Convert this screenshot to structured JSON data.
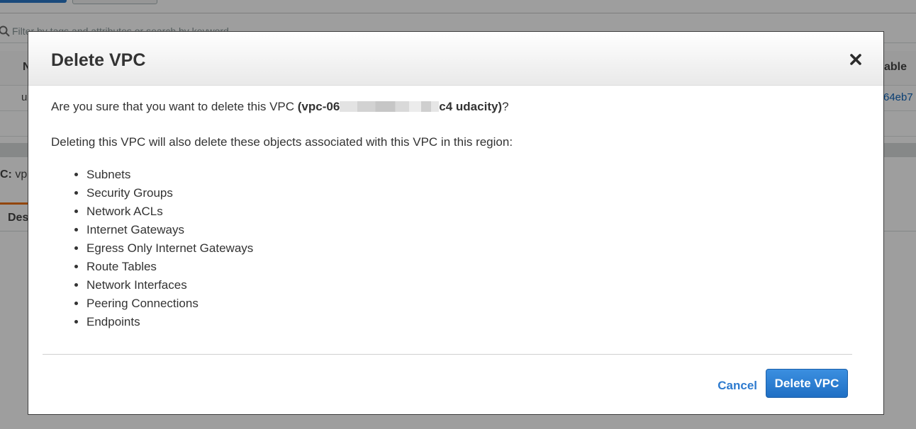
{
  "background": {
    "search_placeholder": "Filter by tags and attributes or search by keyword",
    "table_header": {
      "name_col_fragment": "N",
      "right_col_fragment": "able"
    },
    "row": {
      "name_fragment": "u",
      "right_fragment": "64eb7"
    },
    "detail": {
      "label": "C:",
      "value_fragment": "vp"
    },
    "tab_label_fragment": "Des"
  },
  "modal": {
    "title": "Delete VPC",
    "question_prefix": "Are you sure that you want to delete this VPC ",
    "vpc_open": "(vpc-06",
    "vpc_close": "c4 udacity)",
    "question_suffix": "?",
    "info": "Deleting this VPC will also delete these objects associated with this VPC in this region:",
    "objects": [
      "Subnets",
      "Security Groups",
      "Network ACLs",
      "Internet Gateways",
      "Egress Only Internet Gateways",
      "Route Tables",
      "Network Interfaces",
      "Peering Connections",
      "Endpoints"
    ],
    "cancel_label": "Cancel",
    "delete_label": "Delete VPC"
  },
  "colors": {
    "primary_button": "#1f6fc4",
    "link": "#2e7bcf",
    "text": "#333333",
    "tab_accent": "#ec7211"
  },
  "icons": {
    "close": "close-icon",
    "search": "search-icon"
  }
}
